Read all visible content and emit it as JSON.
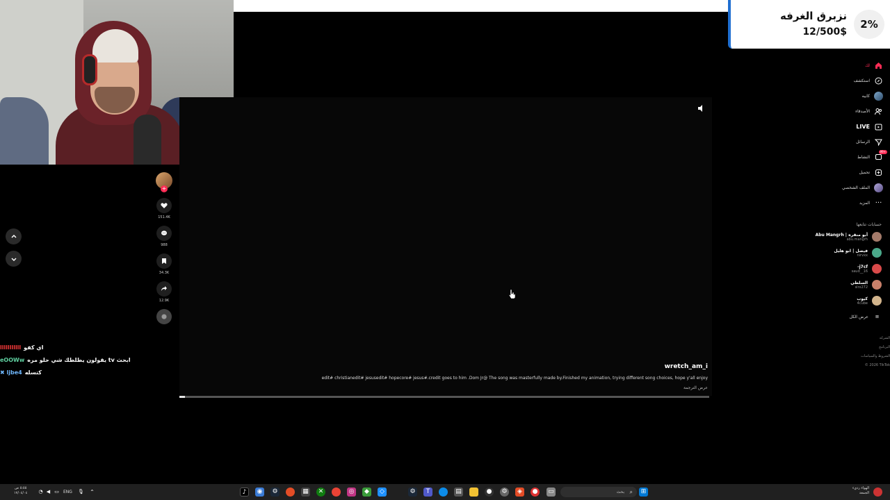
{
  "stream_overlay": {
    "goal_percent": "2%",
    "goal_title": "نزبرق الغرفه",
    "goal_amount": "12/500$"
  },
  "video": {
    "author": "wretch_am_i",
    "caption": "edit# christianedit# jesusedit# hopecore# jesus#.credit goes to him .Dom Jr@ The song was masterfully made by.Finished my animation, trying different song choices, hope y'all enjoy",
    "translate_label": "عرض الترجمة",
    "progress": 0.01
  },
  "actions": {
    "likes": "151.4K",
    "comments": "988",
    "saves": "34.3K",
    "shares": "12.9K"
  },
  "chat": [
    {
      "user": "lllllllllll",
      "message": "اي كفو",
      "user_color": "#ff3b3b"
    },
    {
      "user": "eOOWw",
      "message": "يقولون يطلطك شي حلو مره tv ابحث",
      "user_color": "#5fd0a0"
    },
    {
      "user": "✖ ljbe4",
      "message": "كتسله",
      "user_color": "#6fb8ff"
    }
  ],
  "sidebar": {
    "nav": [
      {
        "label": "لك",
        "icon": "home-icon",
        "accent": true
      },
      {
        "label": "استكشف",
        "icon": "compass-icon"
      },
      {
        "label": "كابيه",
        "icon": "avatar-icon"
      },
      {
        "label": "الأصدقاء",
        "icon": "friends-icon"
      },
      {
        "label": "LIVE",
        "icon": "live-icon",
        "bold": true
      },
      {
        "label": "الرسائل",
        "icon": "send-icon"
      },
      {
        "label": "النشاط",
        "icon": "activity-icon",
        "badge": "99+"
      },
      {
        "label": "تحميل",
        "icon": "upload-icon"
      },
      {
        "label": "الملف الشخصي",
        "icon": "profile-icon"
      },
      {
        "label": "المزيد",
        "icon": "more-icon"
      }
    ],
    "following_title": "حسابات تتابعها",
    "following": [
      {
        "name": "Abu Mangrh | أبو منقره",
        "handle": "abu.mangrh",
        "color": "#a37a6a"
      },
      {
        "name": "فيصل | ابو هليل",
        "handle": "nirvxx",
        "color": "#4aa88a"
      },
      {
        "name": "-j7cf",
        "handle": "saud__16",
        "color": "#d94a4a"
      },
      {
        "name": "السلطي",
        "handle": "slrx272",
        "color": "#c9806a"
      },
      {
        "name": "كيوب",
        "handle": "4cube",
        "color": "#d2b48c"
      }
    ],
    "see_all": "عرض الكل",
    "footer": [
      "الشركة",
      "البرنامج",
      "الشروط والسياسات",
      "© 2026 TikTok"
    ]
  },
  "taskbar": {
    "search_placeholder": "بحث",
    "language": "ENG",
    "clock": "٥:٥٥ ص",
    "date": "١٧/٠٤/٠٤",
    "weather_title": "الهواء رديء",
    "weather_sub": "الجمعة"
  },
  "colors": {
    "accent_red": "#fe2c55",
    "goal_border": "#1f6fd1",
    "taskbar": "#202020"
  }
}
